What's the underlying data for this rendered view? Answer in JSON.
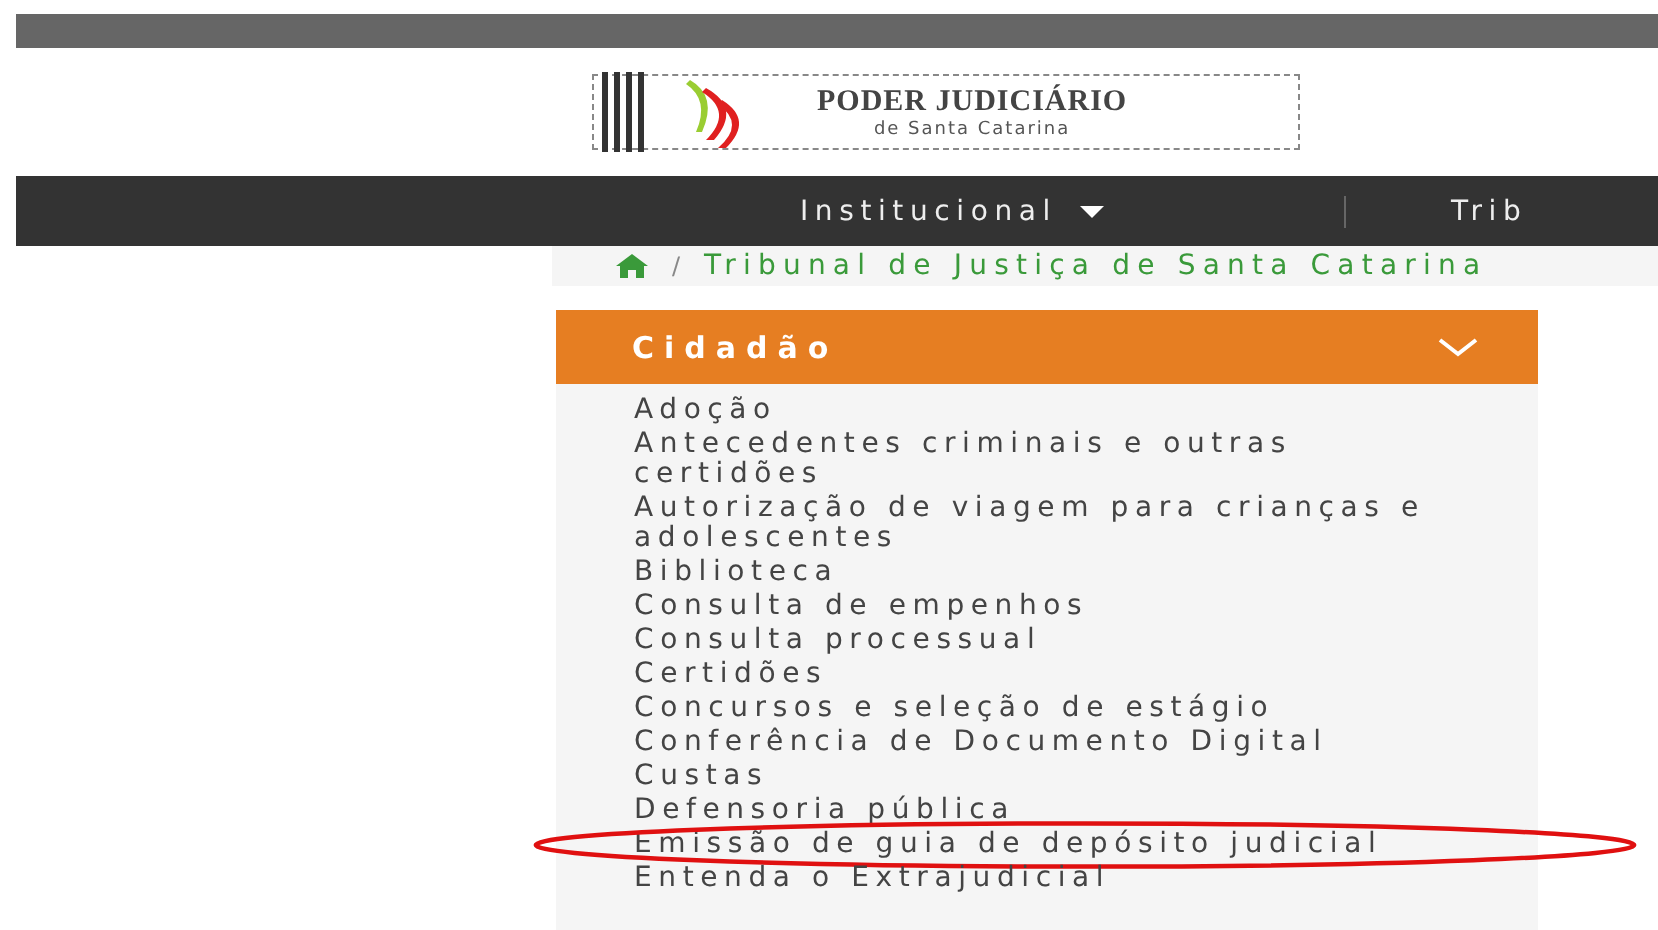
{
  "logo": {
    "title": "PODER JUDICIÁRIO",
    "subtitle": "de Santa Catarina"
  },
  "nav": {
    "items": [
      {
        "label": "Institucional",
        "has_caret": true
      },
      {
        "label": "Trib",
        "has_caret": false
      }
    ]
  },
  "breadcrumb": {
    "separator": "/",
    "current": "Tribunal de Justiça de Santa Catarina"
  },
  "sidebar": {
    "title": "Cidadão",
    "expanded": true,
    "items": [
      {
        "label": "Adoção",
        "highlighted": false
      },
      {
        "label": "Antecedentes criminais e outras certidões",
        "highlighted": false
      },
      {
        "label": "Autorização de viagem para crianças e adolescentes",
        "highlighted": false
      },
      {
        "label": "Biblioteca",
        "highlighted": false
      },
      {
        "label": "Consulta de empenhos",
        "highlighted": false
      },
      {
        "label": "Consulta processual",
        "highlighted": false
      },
      {
        "label": "Certidões",
        "highlighted": false
      },
      {
        "label": "Concursos e seleção de estágio",
        "highlighted": false
      },
      {
        "label": "Conferência de Documento Digital",
        "highlighted": false
      },
      {
        "label": "Custas",
        "highlighted": false
      },
      {
        "label": "Defensoria pública",
        "highlighted": false
      },
      {
        "label": "Emissão de guia de depósito judicial",
        "highlighted": true
      },
      {
        "label": "Entenda o Extrajudicial",
        "highlighted": false
      }
    ]
  }
}
